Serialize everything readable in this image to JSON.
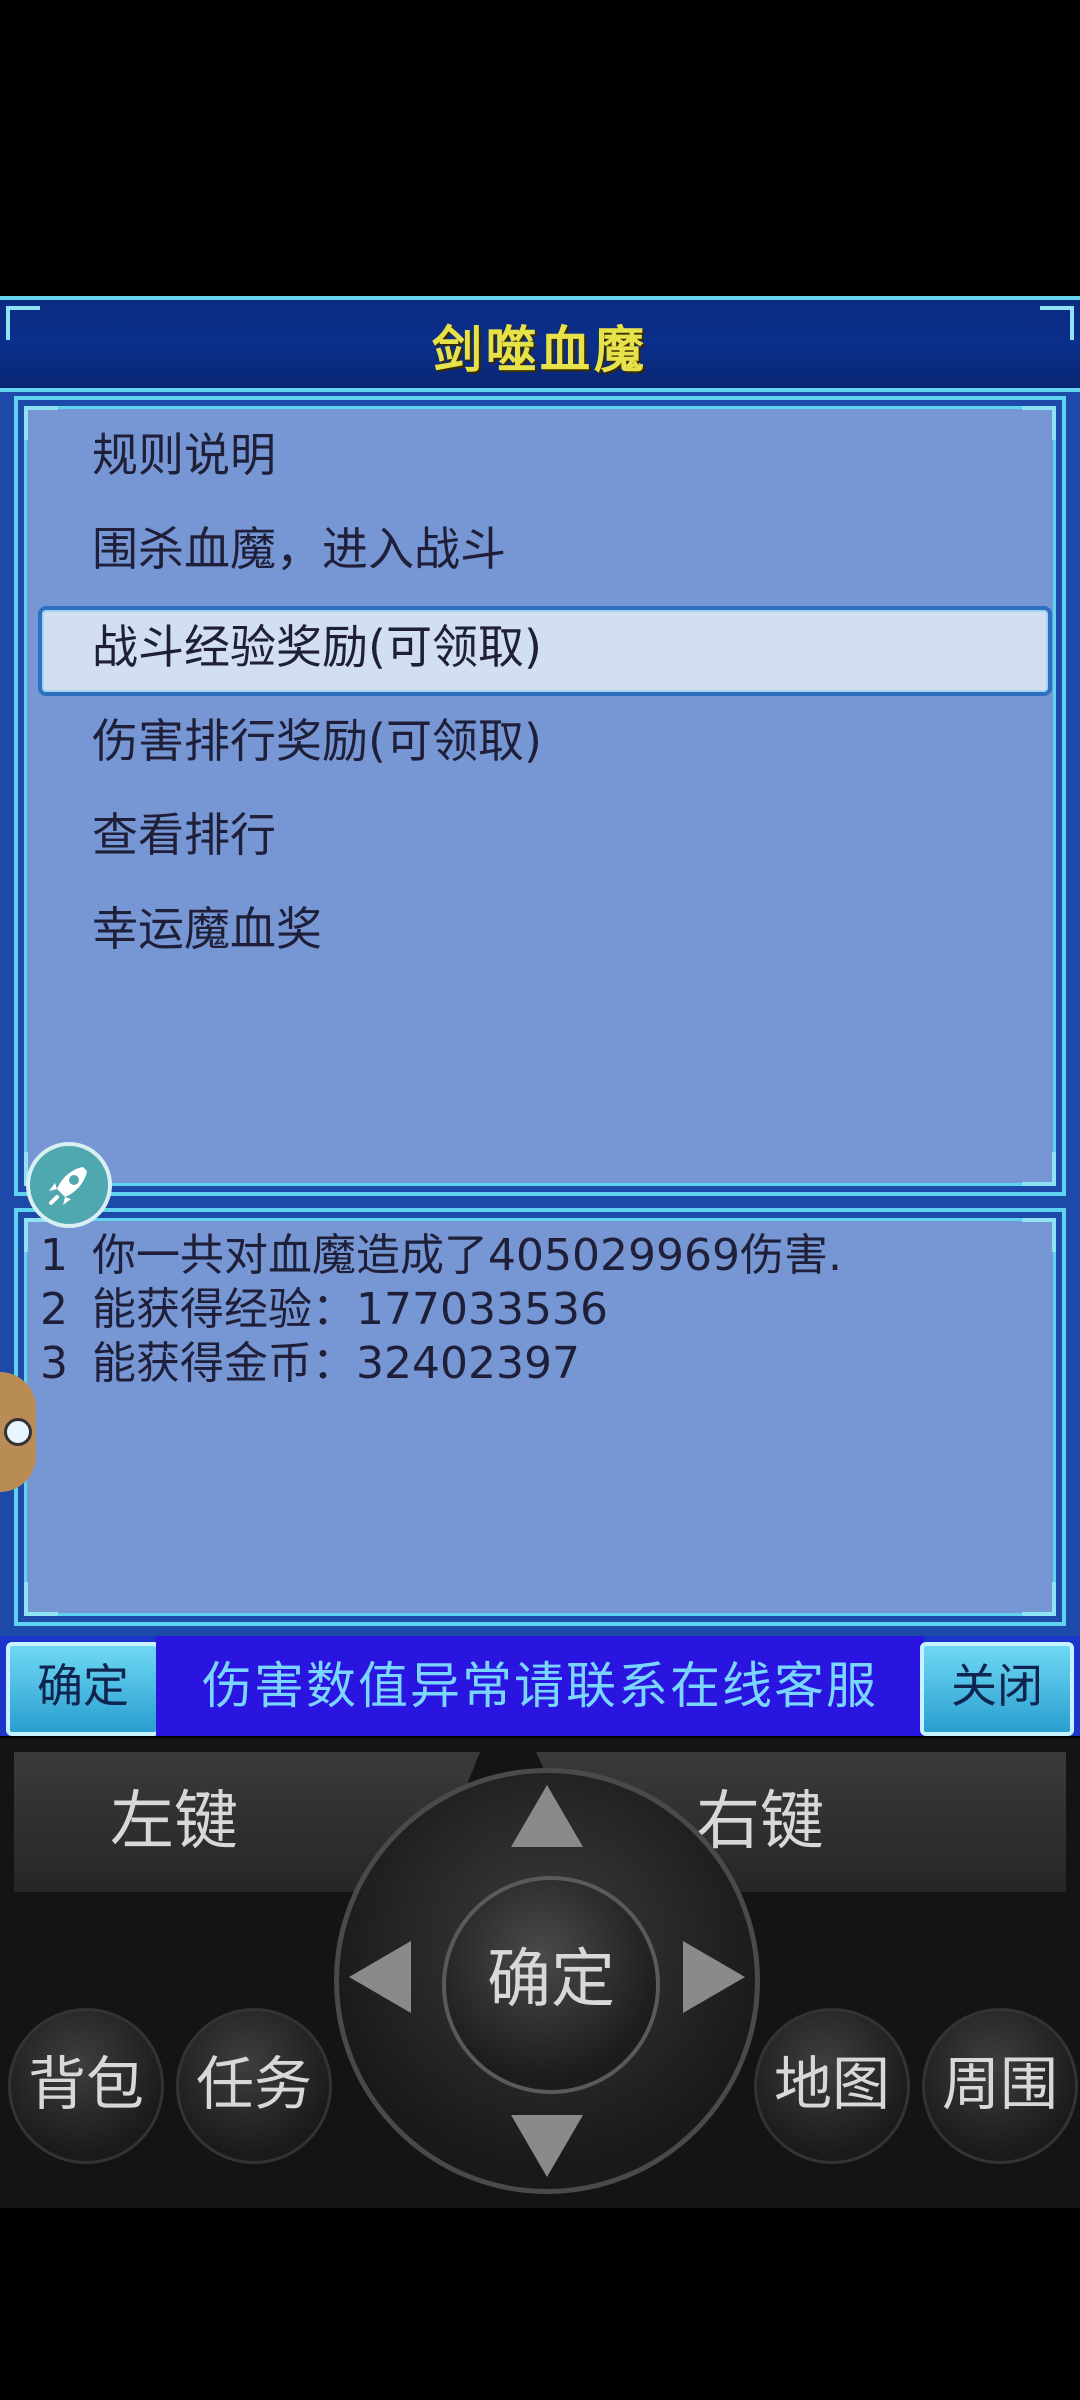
{
  "window": {
    "title": "剑噬血魔"
  },
  "menu": {
    "items": [
      "规则说明",
      "围杀血魔，进入战斗",
      "战斗经验奖励(可领取)",
      "伤害排行奖励(可领取)",
      "查看排行",
      "幸运魔血奖"
    ],
    "selected_index": 2
  },
  "info": {
    "lines": [
      {
        "num": "1",
        "text": "你一共对血魔造成了405029969伤害."
      },
      {
        "num": "2",
        "text": "能获得经验：177033536"
      },
      {
        "num": "3",
        "text": "能获得金币：32402397"
      }
    ]
  },
  "bottom_bar": {
    "confirm_label": "确定",
    "marquee_text": "伤害数值异常请联系在线客服",
    "close_label": "关闭"
  },
  "controls": {
    "left_key": "左键",
    "right_key": "右键",
    "center": "确定",
    "bag": "背包",
    "task": "任务",
    "map": "地图",
    "nearby": "周围"
  },
  "icons": {
    "rocket": "rocket-icon",
    "mascot": "cat-mascot-icon"
  }
}
